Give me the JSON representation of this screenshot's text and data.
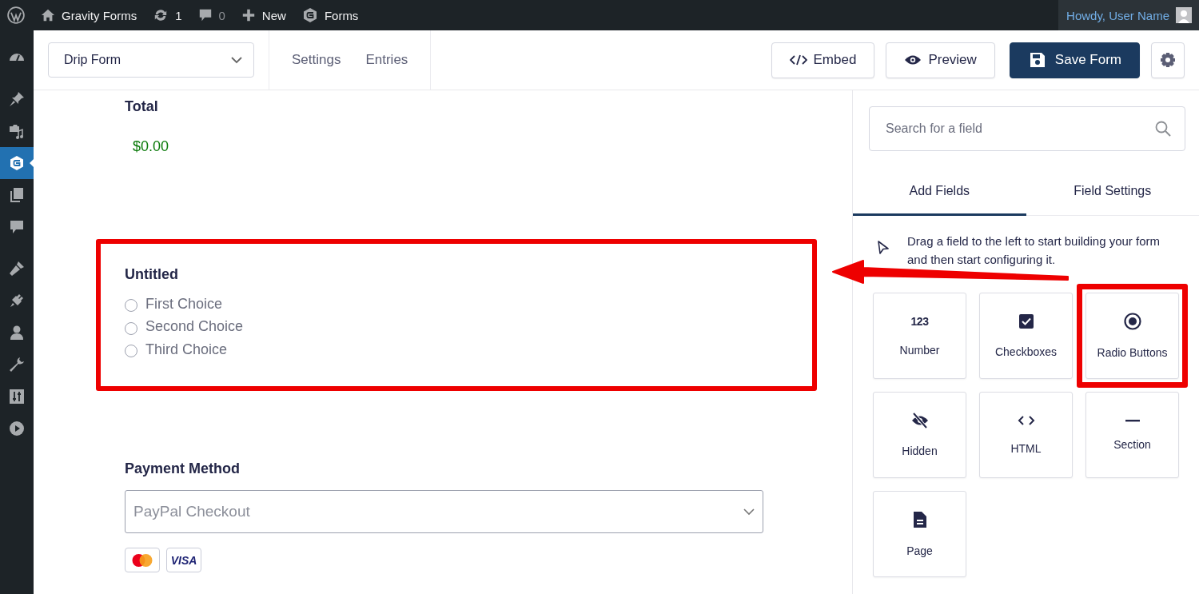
{
  "admin_bar": {
    "site": "Gravity Forms",
    "updates": "1",
    "comments": "0",
    "new": "New",
    "forms": "Forms",
    "greeting": "Howdy, User Name"
  },
  "sidebar": {
    "items": [
      {
        "kind": "dashboard",
        "selected": false
      },
      {
        "kind": "posts",
        "selected": false
      },
      {
        "kind": "media",
        "selected": false
      },
      {
        "kind": "forms",
        "selected": true
      },
      {
        "kind": "pages",
        "selected": false
      },
      {
        "kind": "comments",
        "selected": false
      },
      {
        "kind": "appearance",
        "selected": false
      },
      {
        "kind": "plugins",
        "selected": false
      },
      {
        "kind": "users",
        "selected": false
      },
      {
        "kind": "tools",
        "selected": false
      },
      {
        "kind": "settings",
        "selected": false
      },
      {
        "kind": "video",
        "selected": false
      }
    ]
  },
  "header": {
    "form_select": "Drip Form",
    "links": [
      "Settings",
      "Entries"
    ],
    "embed": "Embed",
    "preview": "Preview",
    "save": "Save Form"
  },
  "form": {
    "fields": [
      {
        "kind": "total",
        "label": "Total",
        "value": "$0.00",
        "highlighted": false
      },
      {
        "kind": "radio",
        "label": "Untitled",
        "highlighted": true,
        "choices": [
          {
            "label": "First Choice",
            "selected": false
          },
          {
            "label": "Second Choice",
            "selected": false
          },
          {
            "label": "Third Choice",
            "selected": false
          }
        ]
      },
      {
        "kind": "payment",
        "label": "Payment Method",
        "value": "PayPal Checkout",
        "highlighted": false,
        "cards": [
          {
            "kind": "mastercard"
          },
          {
            "kind": "visa",
            "label": "VISA"
          }
        ]
      }
    ]
  },
  "panel": {
    "search": {
      "placeholder": "Search for a field"
    },
    "tabs": [
      {
        "label": "Add Fields",
        "selected": true
      },
      {
        "label": "Field Settings",
        "selected": false
      }
    ],
    "hint": "Drag a field to the left to start building your form and then start configuring it.",
    "fields": [
      {
        "kind": "number",
        "glyph": "123",
        "label": "Number",
        "highlighted": false
      },
      {
        "kind": "checkboxes",
        "label": "Checkboxes",
        "highlighted": false
      },
      {
        "kind": "radio",
        "label": "Radio Buttons",
        "highlighted": true
      },
      {
        "kind": "hidden",
        "label": "Hidden",
        "highlighted": false
      },
      {
        "kind": "html",
        "label": "HTML",
        "highlighted": false
      },
      {
        "kind": "section",
        "label": "Section",
        "highlighted": false
      },
      {
        "kind": "page",
        "label": "Page",
        "highlighted": false
      }
    ]
  }
}
